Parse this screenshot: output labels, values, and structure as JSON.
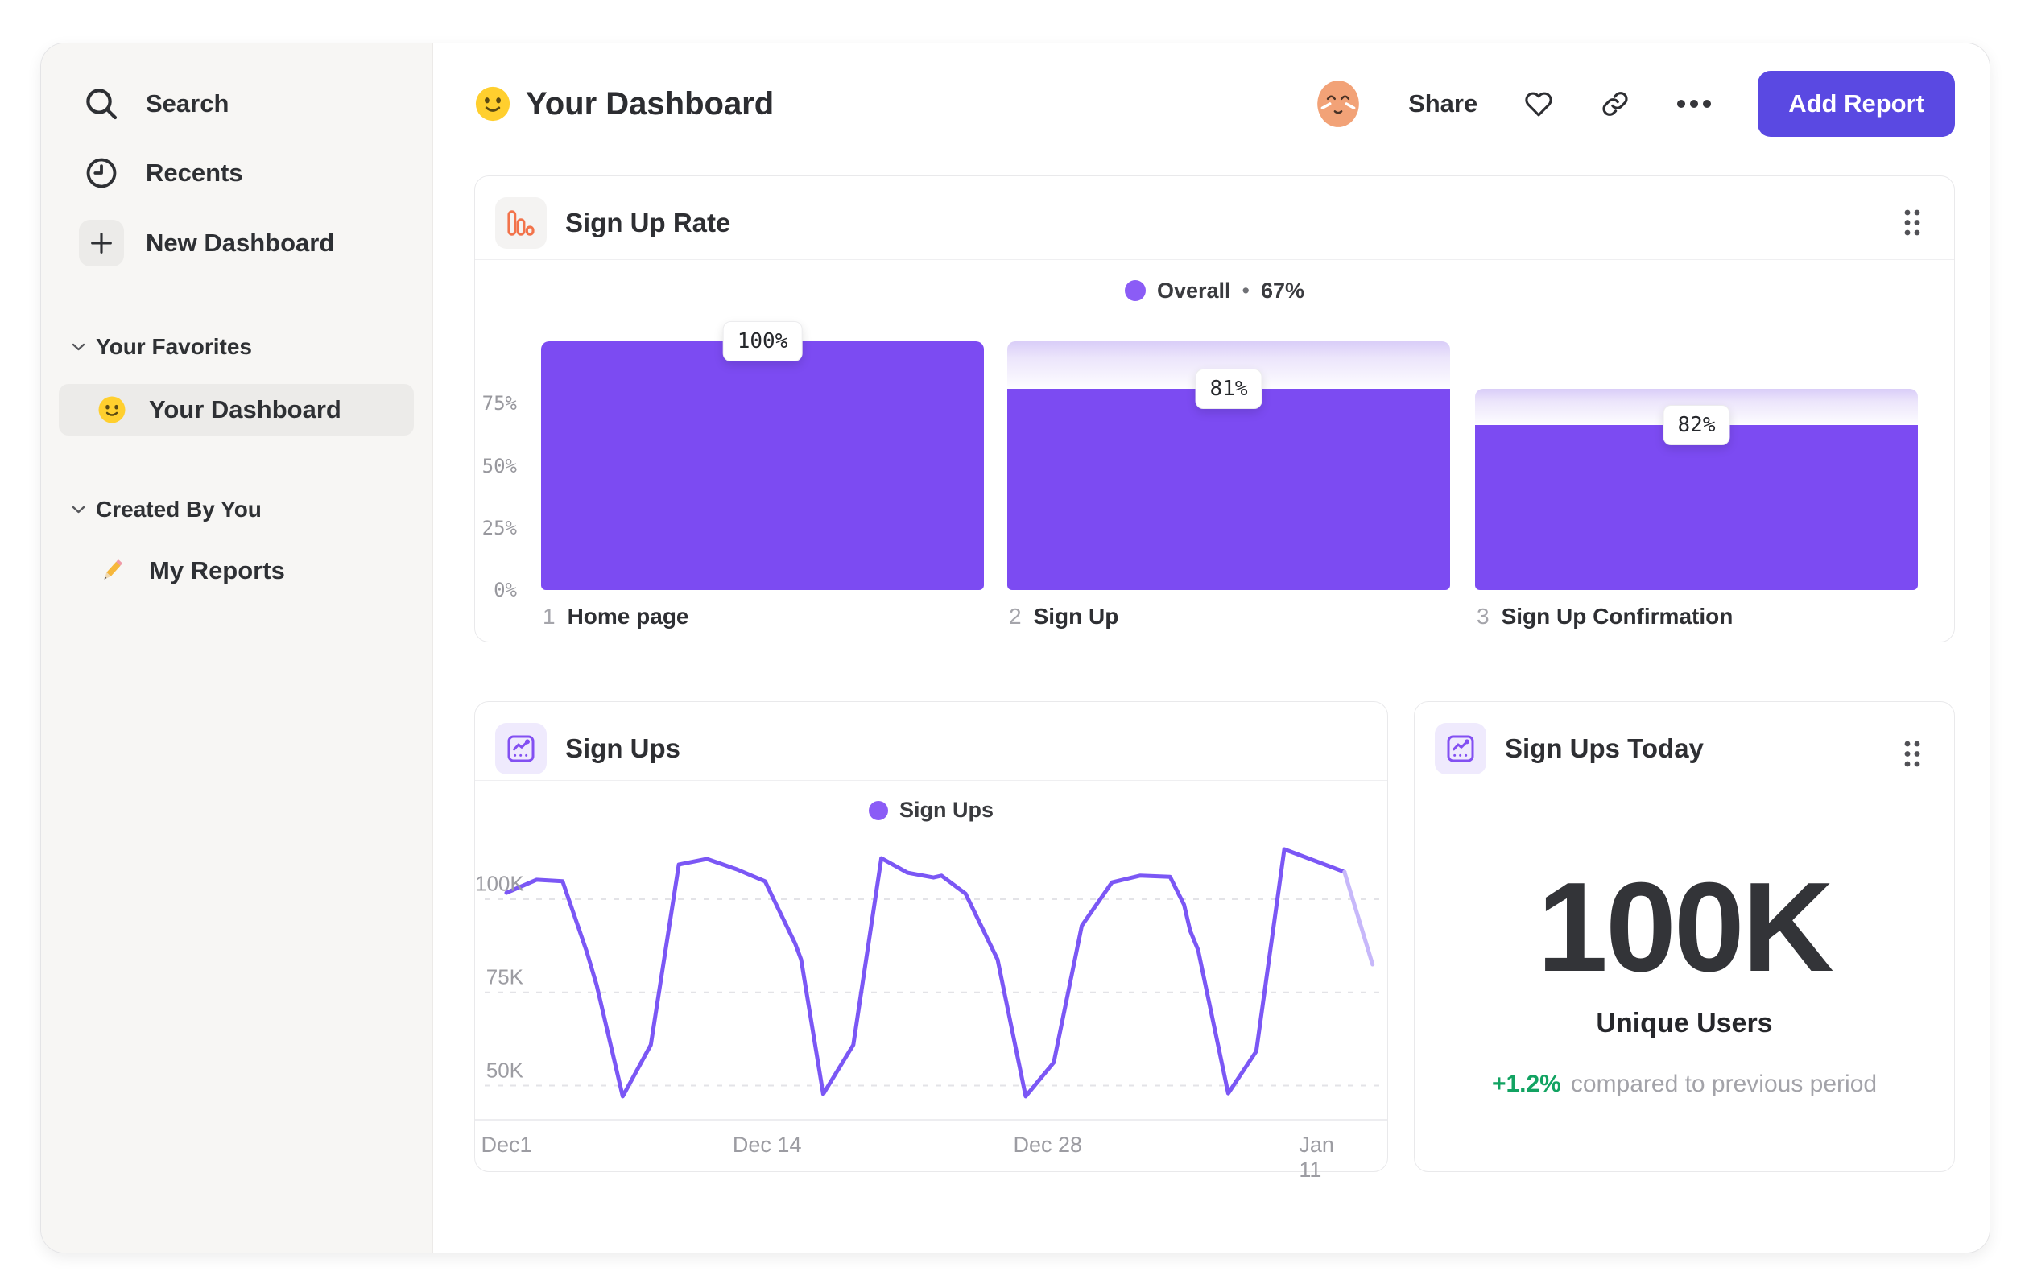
{
  "header": {
    "title": "Your Dashboard",
    "share_label": "Share",
    "add_report_label": "Add Report"
  },
  "sidebar": {
    "items": [
      {
        "label": "Search"
      },
      {
        "label": "Recents"
      },
      {
        "label": "New Dashboard"
      }
    ],
    "sections": [
      {
        "label": "Your Favorites",
        "items": [
          {
            "label": "Your Dashboard",
            "emoji": "smiley-emoji",
            "active": true
          }
        ]
      },
      {
        "label": "Created By You",
        "items": [
          {
            "label": "My Reports",
            "emoji": "pencil-emoji",
            "active": false
          }
        ]
      }
    ]
  },
  "colors": {
    "accent_purple": "#7c4bf2",
    "line_purple": "#7b57f5",
    "line_projected": "#c7b8fa",
    "legend_dot": "#8b5cf6",
    "funnel_icon_orange": "#f2734b",
    "button_indigo": "#5a49e2",
    "delta_green": "#12a362"
  },
  "chart_data": [
    {
      "type": "bar",
      "variant": "funnel",
      "title": "Sign Up Rate",
      "legend": {
        "name": "Overall",
        "separator": "•",
        "value": "67%"
      },
      "ylim": [
        0,
        100
      ],
      "y_ticks": [
        {
          "label": "75%",
          "value": 75
        },
        {
          "label": "50%",
          "value": 50
        },
        {
          "label": "25%",
          "value": 25
        },
        {
          "label": "0%",
          "value": 0
        }
      ],
      "steps": [
        {
          "index": "1",
          "label": "Home page",
          "step_conversion_pct": 100,
          "cumulative_pct": 100,
          "tooltip": "100%"
        },
        {
          "index": "2",
          "label": "Sign Up",
          "step_conversion_pct": 81,
          "cumulative_pct": 81,
          "tooltip": "81%"
        },
        {
          "index": "3",
          "label": "Sign Up Confirmation",
          "step_conversion_pct": 82,
          "cumulative_pct": 66.4,
          "tooltip": "82%"
        }
      ]
    },
    {
      "type": "line",
      "title": "Sign Ups",
      "legend_label": "Sign Ups",
      "unit": "K",
      "ylim": [
        40,
        115
      ],
      "grid": "dashed-horizontal",
      "y_ticks": [
        {
          "label": "100K",
          "value": 100
        },
        {
          "label": "75K",
          "value": 75
        },
        {
          "label": "50K",
          "value": 50
        }
      ],
      "x_ticks": [
        {
          "label": "Dec1",
          "day": 0
        },
        {
          "label": "Dec 14",
          "day": 13
        },
        {
          "label": "Dec 28",
          "day": 27
        },
        {
          "label": "Jan 11",
          "day": 41
        }
      ],
      "points": [
        [
          0,
          101.7
        ],
        [
          1.5,
          105.2
        ],
        [
          2.8,
          104.8
        ],
        [
          4.0,
          86.0
        ],
        [
          4.5,
          76.9
        ],
        [
          5.8,
          47.1
        ],
        [
          7.2,
          60.9
        ],
        [
          8.6,
          109.3
        ],
        [
          10.0,
          110.8
        ],
        [
          11.5,
          108.0
        ],
        [
          12.9,
          104.8
        ],
        [
          13.5,
          98.1
        ],
        [
          14.4,
          88.1
        ],
        [
          14.7,
          83.8
        ],
        [
          15.8,
          47.7
        ],
        [
          17.3,
          60.9
        ],
        [
          18.7,
          111.0
        ],
        [
          20.0,
          107.1
        ],
        [
          21.3,
          105.8
        ],
        [
          21.7,
          106.3
        ],
        [
          22.9,
          101.5
        ],
        [
          24.5,
          83.8
        ],
        [
          25.9,
          47.1
        ],
        [
          27.3,
          56.2
        ],
        [
          28.7,
          92.9
        ],
        [
          30.2,
          104.5
        ],
        [
          31.6,
          106.3
        ],
        [
          33.1,
          106.0
        ],
        [
          33.8,
          98.5
        ],
        [
          34.1,
          91.6
        ],
        [
          34.5,
          86.4
        ],
        [
          36.0,
          47.9
        ],
        [
          37.4,
          59.2
        ],
        [
          38.8,
          113.4
        ],
        [
          41.8,
          107.3
        ]
      ],
      "projected_points": [
        [
          41.8,
          107.3
        ],
        [
          43.2,
          82.5
        ]
      ]
    },
    {
      "type": "stat",
      "title": "Sign Ups Today",
      "value": "100K",
      "label": "Unique Users",
      "delta": "+1.2%",
      "note": "compared to previous period"
    }
  ]
}
